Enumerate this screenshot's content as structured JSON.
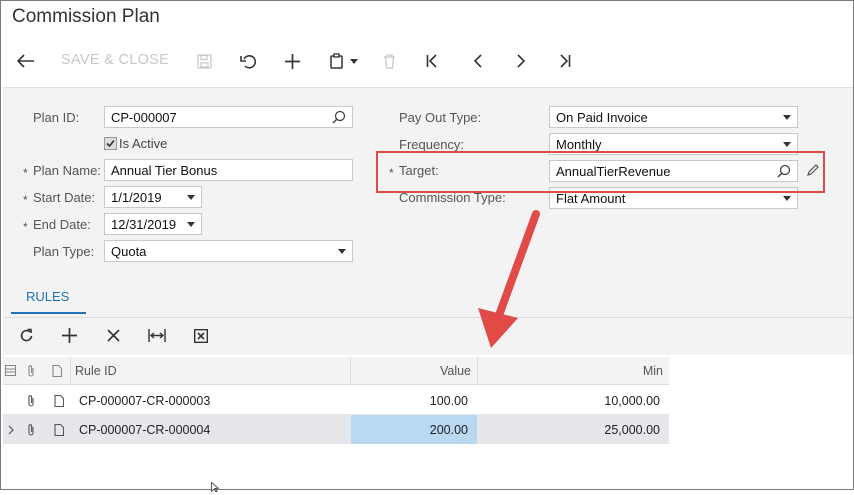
{
  "window": {
    "title": "Commission Plan"
  },
  "toolbar": {
    "save_close_label": "SAVE & CLOSE"
  },
  "form": {
    "plan_id_label": "Plan ID:",
    "plan_id_value": "CP-000007",
    "is_active_label": "Is Active",
    "is_active_checked": true,
    "plan_name_label": "Plan Name:",
    "plan_name_value": "Annual Tier Bonus",
    "start_date_label": "Start Date:",
    "start_date_value": "1/1/2019",
    "end_date_label": "End Date:",
    "end_date_value": "12/31/2019",
    "plan_type_label": "Plan Type:",
    "plan_type_value": "Quota",
    "pay_out_type_label": "Pay Out Type:",
    "pay_out_type_value": "On Paid Invoice",
    "frequency_label": "Frequency:",
    "frequency_value": "Monthly",
    "target_label": "Target:",
    "target_value": "AnnualTierRevenue",
    "commission_type_label": "Commission Type:",
    "commission_type_value": "Flat Amount",
    "required_marker": "*"
  },
  "tabs": [
    {
      "label": "RULES",
      "active": true
    }
  ],
  "grid": {
    "columns": {
      "rule_id": "Rule ID",
      "value": "Value",
      "min": "Min"
    },
    "rows": [
      {
        "rule_id": "CP-000007-CR-000003",
        "value": "100.00",
        "min": "10,000.00"
      },
      {
        "rule_id": "CP-000007-CR-000004",
        "value": "200.00",
        "min": "25,000.00"
      }
    ]
  },
  "colors": {
    "accent": "#1e73b8",
    "annotation": "#e04b47",
    "selected_cell": "#b9d8f2",
    "selected_row": "#e6e7ea"
  }
}
